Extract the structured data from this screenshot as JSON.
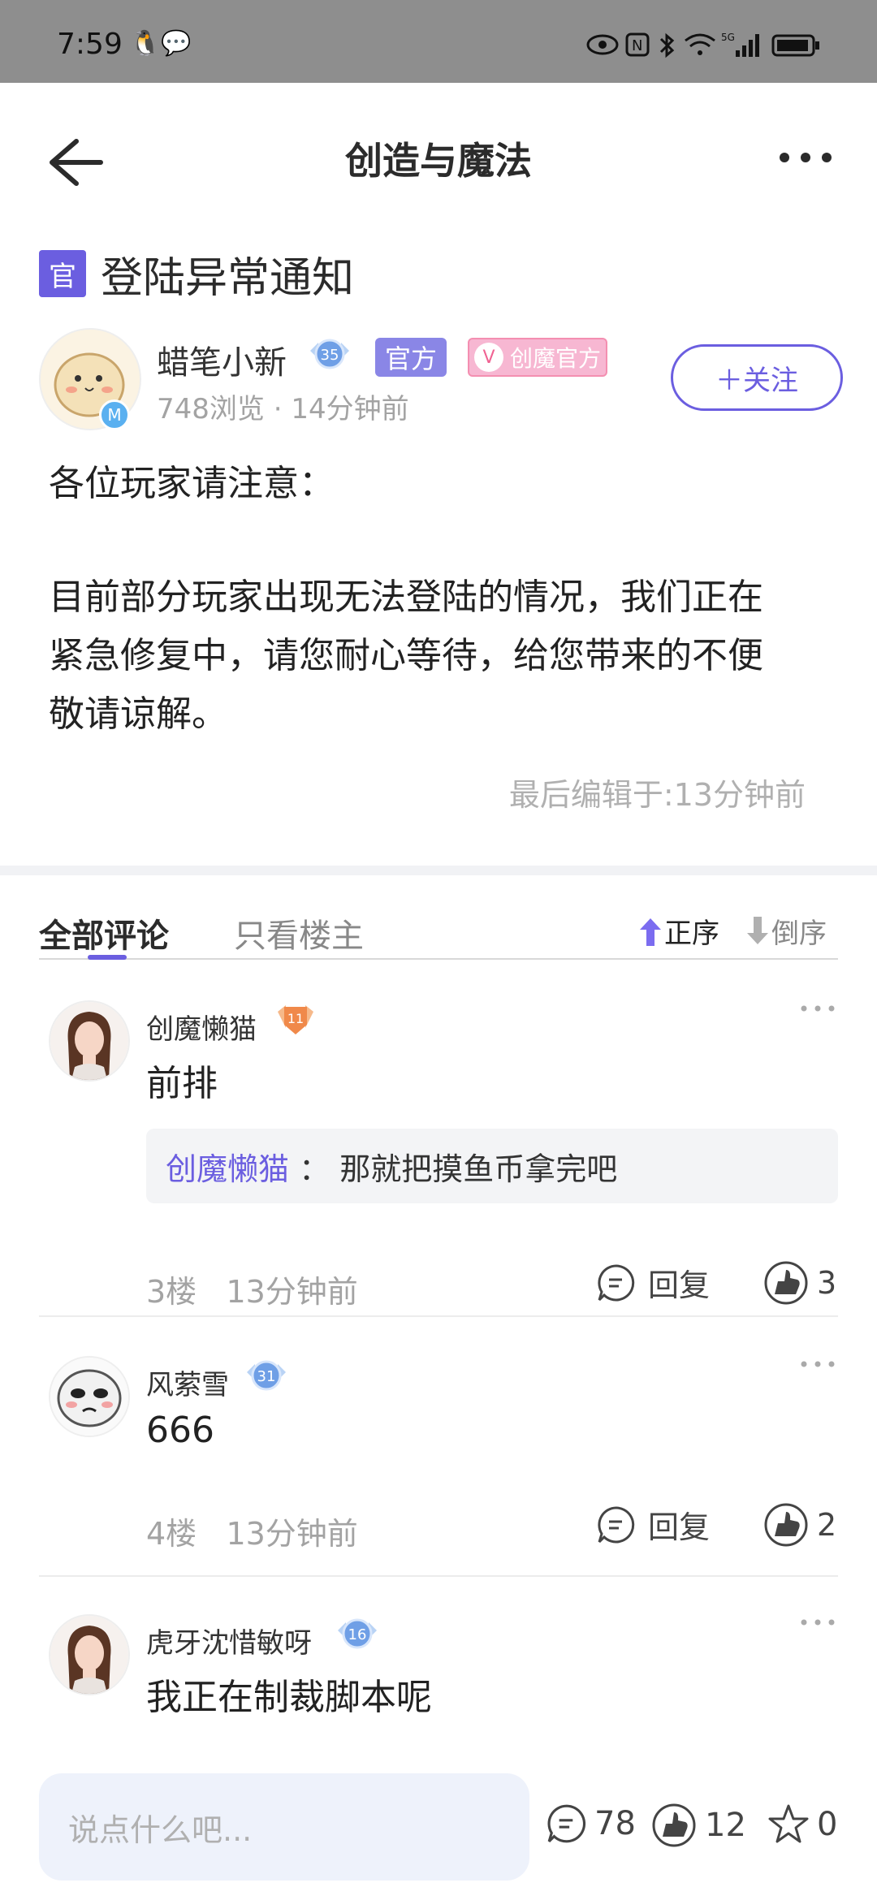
{
  "status_bar": {
    "time": "7:59",
    "network": "5G"
  },
  "nav": {
    "title": "创造与魔法"
  },
  "post": {
    "badge": "官",
    "title": "登陆异常通知",
    "author": "蜡笔小新",
    "author_level": "35",
    "tag_official": "官方",
    "tag_cm": "创魔官方",
    "views": "748浏览",
    "time": "14分钟前",
    "follow": "＋关注",
    "body_line1": "各位玩家请注意：",
    "body_line2": "目前部分玩家出现无法登陆的情况，我们正在",
    "body_line3": "紧急修复中，请您耐心等待，给您带来的不便",
    "body_line4": "敬请谅解。",
    "edited": "最后编辑于:13分钟前"
  },
  "tabs": {
    "all": "全部评论",
    "owner_only": "只看楼主",
    "asc": "正序",
    "desc": "倒序"
  },
  "comments": [
    {
      "name": "创魔懒猫",
      "level": "11",
      "text": "前排",
      "quote_name": "创魔懒猫",
      "quote_sep": " ： ",
      "quote_text": "那就把摸鱼币拿完吧",
      "floor": "3楼",
      "time": "13分钟前",
      "reply": "回复",
      "likes": "3"
    },
    {
      "name": "风萦雪",
      "level": "31",
      "text": "666",
      "floor": "4楼",
      "time": "13分钟前",
      "reply": "回复",
      "likes": "2"
    },
    {
      "name": "虎牙沈惜敏呀",
      "level": "16",
      "text": "我正在制裁脚本呢"
    }
  ],
  "bottom": {
    "placeholder": "说点什么吧...",
    "comments": "78",
    "likes": "12",
    "stars": "0"
  },
  "colors": {
    "accent": "#6b5ee0",
    "statusbar": "#8e8e8e",
    "badge_pink": "#f7b7d2"
  }
}
